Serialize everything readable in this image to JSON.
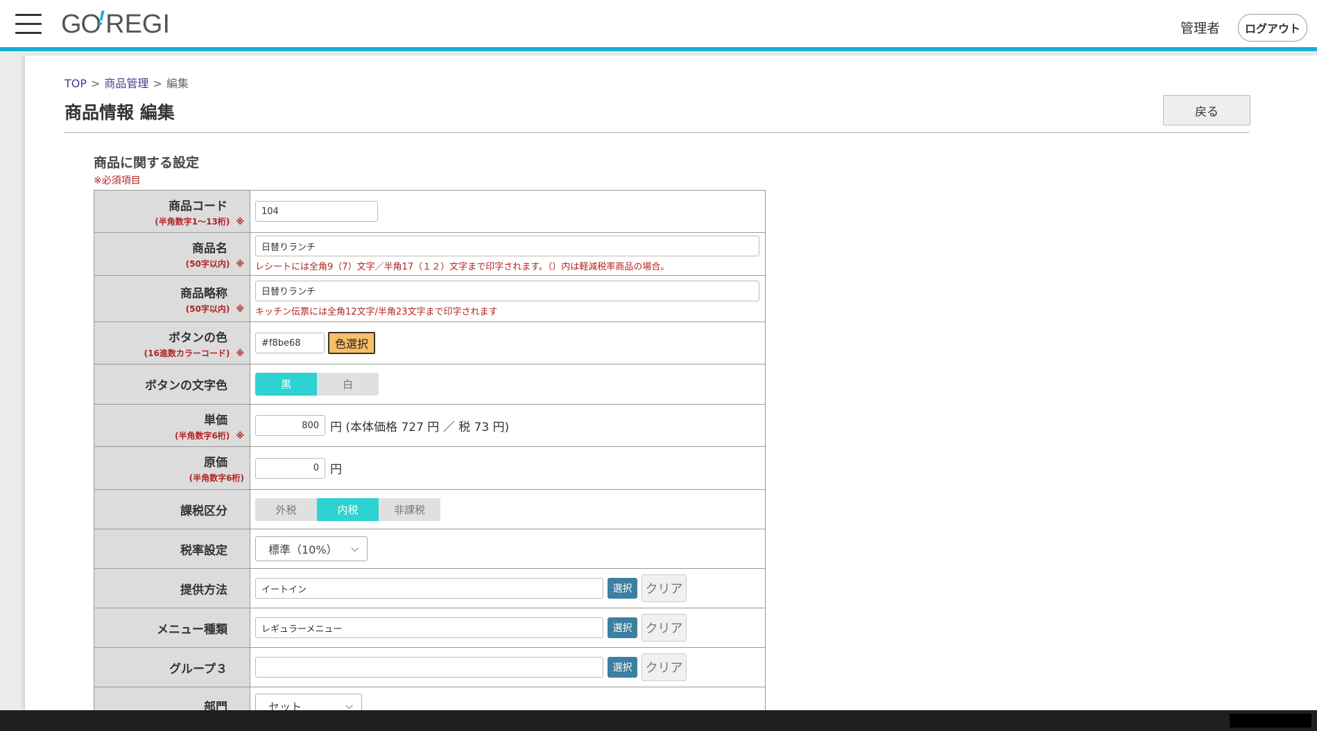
{
  "header": {
    "logo": {
      "go": "GO",
      "mark": "!",
      "regi": "REGI"
    },
    "user": "管理者",
    "logout_label": "ログアウト"
  },
  "breadcrumb": {
    "top": "TOP",
    "sep": ">",
    "product_mgmt": "商品管理",
    "current": "編集"
  },
  "page_title": "商品情報 編集",
  "back_label": "戻る",
  "section_title": "商品に関する設定",
  "required_note": "※必須項目",
  "form": {
    "code": {
      "label": "商品コード",
      "sub": "(半角数字1〜13桁)",
      "mark": "※",
      "value": "104"
    },
    "name": {
      "label": "商品名",
      "sub": "(50字以内)",
      "mark": "※",
      "value": "日替りランチ",
      "hint": "レシートには全角9（7）文字／半角17（１２）文字まで印字されます。（）内は軽減税率商品の場合。"
    },
    "short_name": {
      "label": "商品略称",
      "sub": "(50字以内)",
      "mark": "※",
      "value": "日替りランチ",
      "hint": "キッチン伝票には全角12文字/半角23文字まで印字されます"
    },
    "button_color": {
      "label": "ボタンの色",
      "sub": "(16進数カラーコード)",
      "mark": "※",
      "value": "#f8be68",
      "button": "色選択"
    },
    "text_color": {
      "label": "ボタンの文字色",
      "options": [
        "黒",
        "白"
      ],
      "selected": "黒"
    },
    "price": {
      "label": "単価",
      "sub": "(半角数字6桁)",
      "mark": "※",
      "value": "800",
      "detail": "円 (本体価格 727 円 ／ 税 73 円)"
    },
    "cost": {
      "label": "原価",
      "sub": "(半角数字6桁)",
      "value": "0",
      "unit": "円"
    },
    "tax_type": {
      "label": "課税区分",
      "options": [
        "外税",
        "内税",
        "非課税"
      ],
      "selected": "内税"
    },
    "tax_rate": {
      "label": "税率設定",
      "value": "標準（10%）"
    },
    "serve_method": {
      "label": "提供方法",
      "value": "イートイン",
      "select": "選択",
      "clear": "クリア"
    },
    "menu_type": {
      "label": "メニュー種類",
      "value": "レギュラーメニュー",
      "select": "選択",
      "clear": "クリア"
    },
    "group3": {
      "label": "グループ３",
      "value": "",
      "select": "選択",
      "clear": "クリア"
    },
    "department": {
      "label": "部門",
      "value": "セット"
    }
  },
  "colors": {
    "accent": "#13b1d6",
    "toggle_on": "#2ed2d2",
    "required": "#b22222",
    "select_btn": "#3d7fa0",
    "swatch": "#f8be68"
  }
}
